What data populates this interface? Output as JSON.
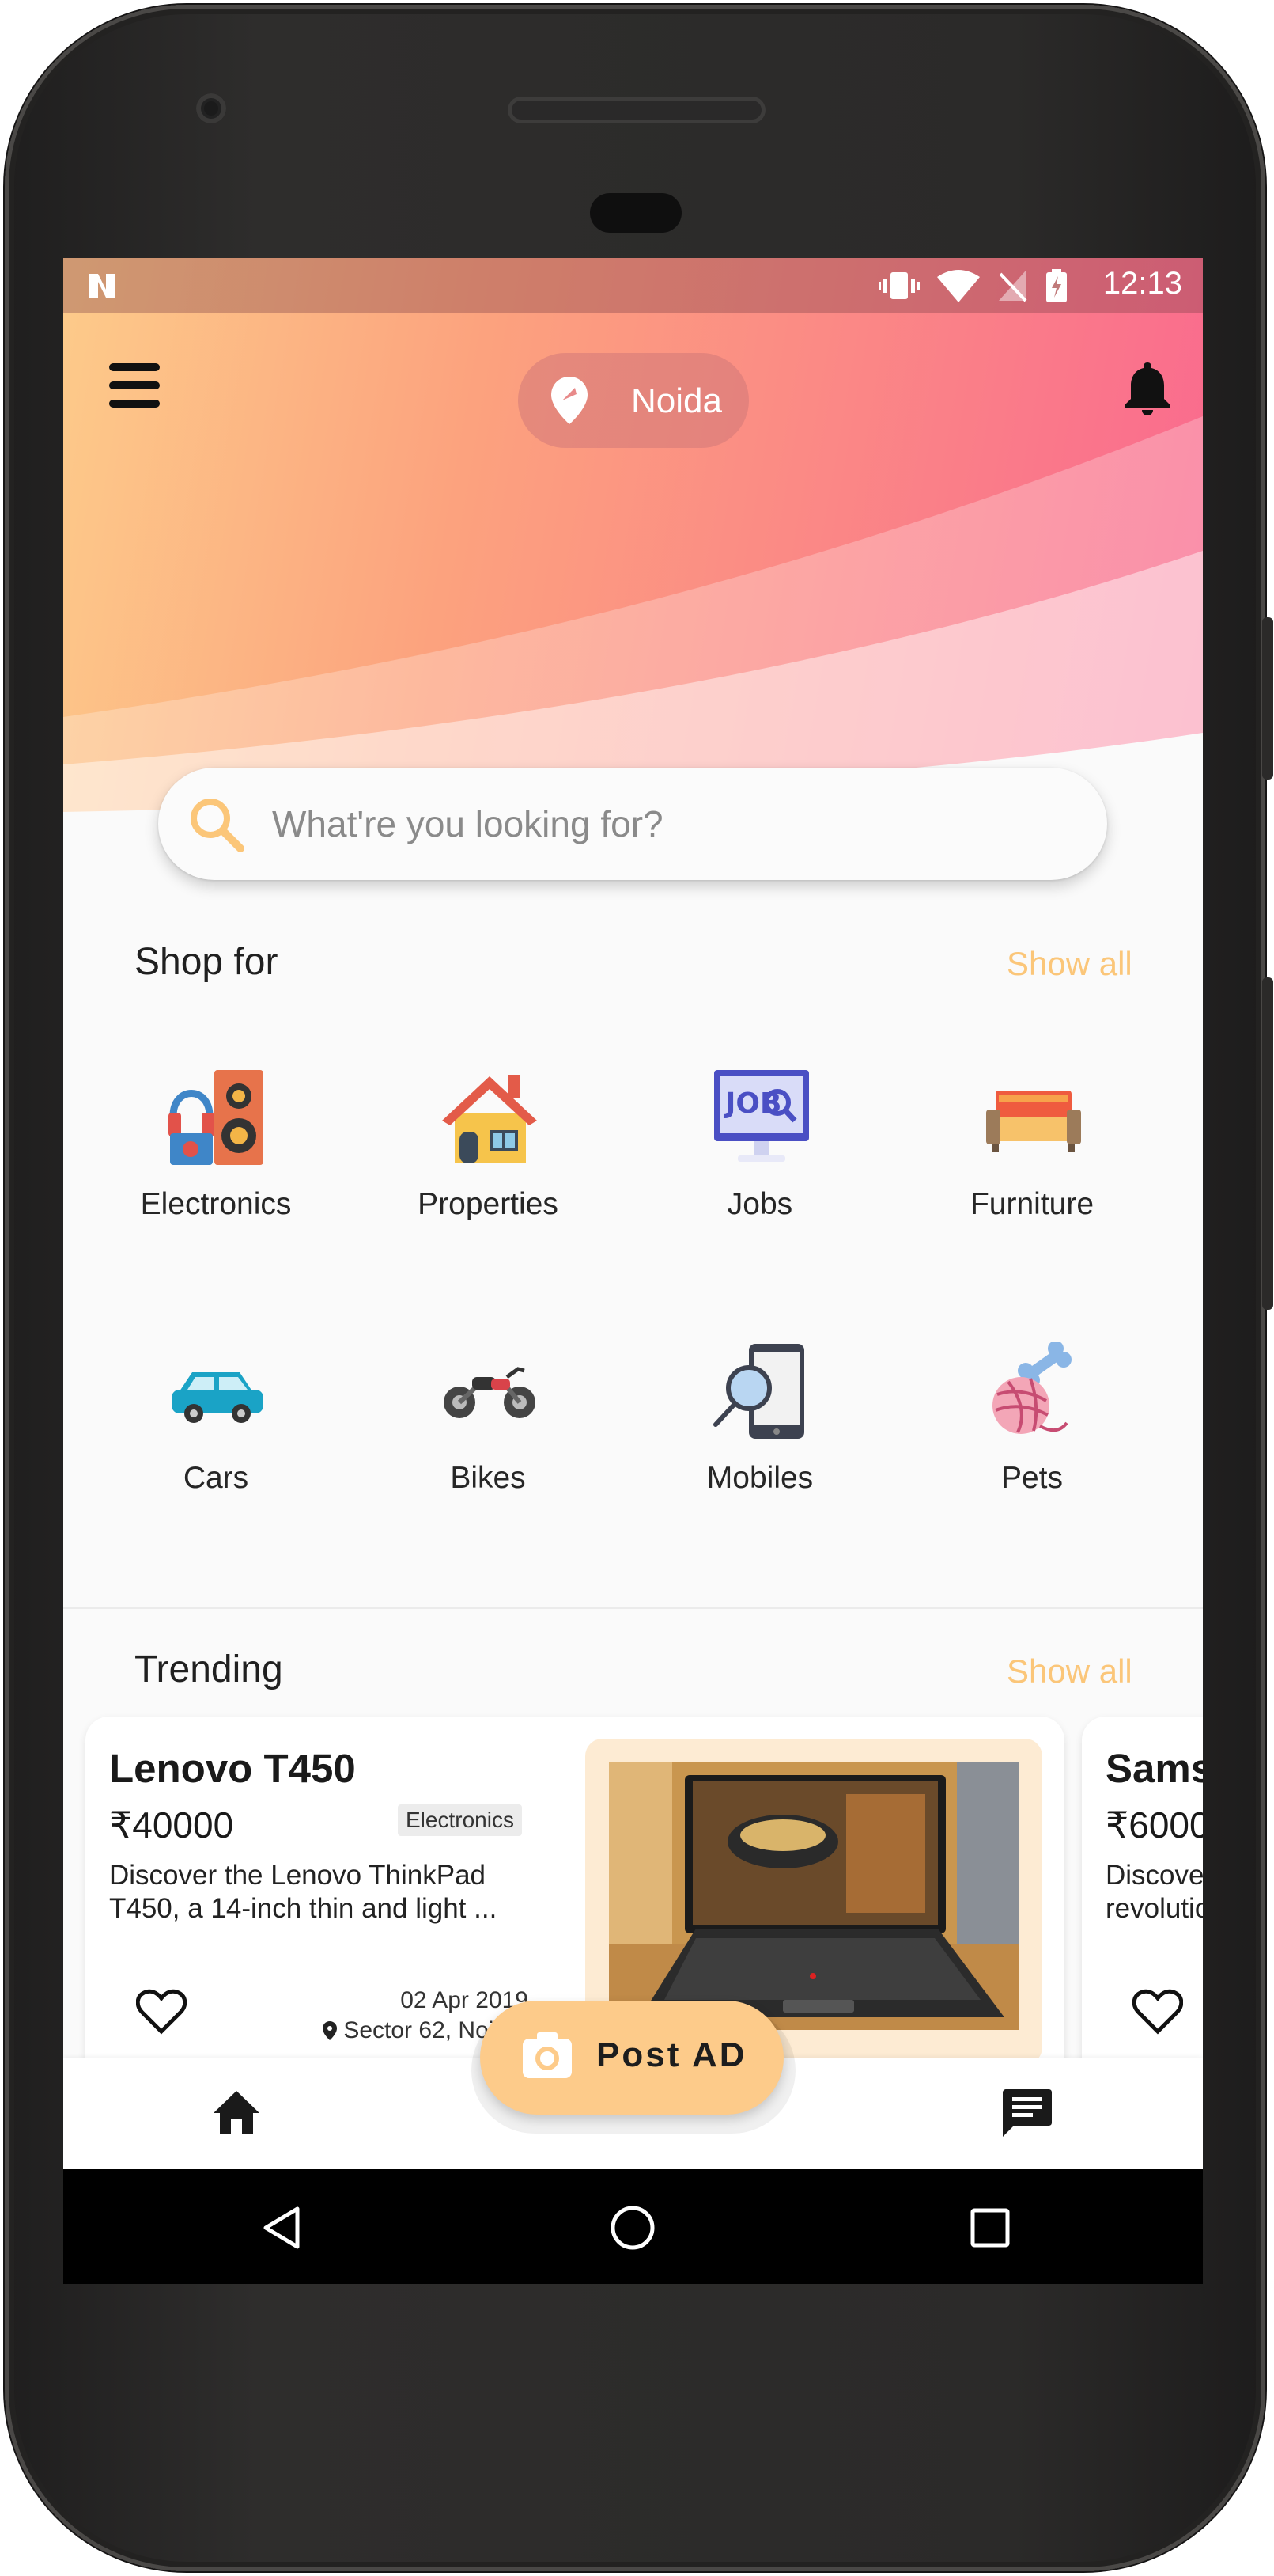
{
  "status_bar": {
    "time": "12:13"
  },
  "header": {
    "location": "Noida",
    "icons": {
      "menu": "hamburger-icon",
      "location": "location-pin-icon",
      "notifications": "bell-icon"
    }
  },
  "search": {
    "placeholder": "What're you looking for?",
    "icon": "search-icon"
  },
  "shop_for": {
    "title": "Shop for",
    "show_all": "Show all",
    "categories": [
      {
        "label": "Electronics",
        "icon": "speaker-headphones-icon"
      },
      {
        "label": "Properties",
        "icon": "house-icon"
      },
      {
        "label": "Jobs",
        "icon": "job-monitor-icon"
      },
      {
        "label": "Furniture",
        "icon": "sofa-icon"
      },
      {
        "label": "Cars",
        "icon": "car-icon"
      },
      {
        "label": "Bikes",
        "icon": "motorbike-icon"
      },
      {
        "label": "Mobiles",
        "icon": "phone-magnifier-icon"
      },
      {
        "label": "Pets",
        "icon": "yarn-bone-icon"
      }
    ]
  },
  "trending": {
    "title": "Trending",
    "show_all": "Show all",
    "items": [
      {
        "title": "Lenovo T450",
        "price": "₹40000",
        "category": "Electronics",
        "description": "Discover the Lenovo ThinkPad T450, a 14-inch thin and light ...",
        "date": "02 Apr 2019",
        "location": "Sector 62, Noida"
      },
      {
        "title": "Sams",
        "price": "₹6000",
        "description": "Discover revolutio"
      }
    ]
  },
  "post_ad": {
    "label": "Post AD"
  },
  "bottom_nav": {
    "home": "home-icon",
    "chat": "chat-icon"
  },
  "colors": {
    "accent": "#fdcb8a",
    "show_all": "#fbc679",
    "hero_start": "#fdcb8a",
    "hero_end": "#f9678f"
  }
}
